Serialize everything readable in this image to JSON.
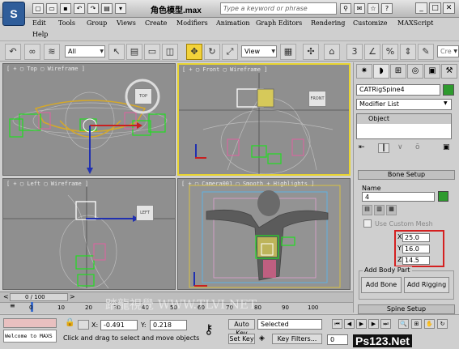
{
  "window": {
    "doc_title": "角色模型.max",
    "search_placeholder": "Type a keyword or phrase"
  },
  "menu": {
    "items": [
      "Edit",
      "Tools",
      "Group",
      "Views",
      "Create",
      "Modifiers",
      "Animation",
      "Graph Editors",
      "Rendering",
      "Customize",
      "MAXScript",
      "Help"
    ]
  },
  "toolbar": {
    "filter": "All",
    "ref_coord": "View"
  },
  "viewports": {
    "top": {
      "label": "[ + ▢ Top ▢ Wireframe ]",
      "cube": "TOP"
    },
    "front": {
      "label": "[ + ▢ Front ▢ Wireframe ]",
      "cube": "FRONT"
    },
    "left": {
      "label": "[ + ▢ Left ▢ Wireframe ]",
      "cube": "LEFT"
    },
    "camera": {
      "label": "[ + ▢ Camera001 ▢ Smooth + Highlights ]"
    }
  },
  "command_panel": {
    "object_name": "CATRigSpine4",
    "object_color": "#2e9a2e",
    "modifier_list": "Modifier List",
    "stack_item": "Object",
    "bone_setup": {
      "header": "Bone Setup",
      "name_label": "Name",
      "name_value": "4",
      "custom_mesh": "Use Custom Mesh",
      "x_label": "X",
      "x_value": "25.0",
      "y_label": "Y",
      "y_value": "16.0",
      "z_label": "Z",
      "z_value": "14.5"
    },
    "add_body_part": {
      "header": "Add Body Part",
      "add_bone": "Add Bone",
      "add_rigging": "Add Rigging"
    },
    "spine_setup": "Spine Setup"
  },
  "timeline": {
    "frame_counter": "0 / 100",
    "ticks": [
      "0",
      "10",
      "20",
      "30",
      "40",
      "50",
      "60",
      "70",
      "80",
      "90",
      "100"
    ],
    "watermark": "踏龍視覺 WWW.TLVI.NET"
  },
  "status": {
    "welcome": "Welcome to MAXS",
    "x_label": "X:",
    "x_value": "-0.491",
    "y_label": "Y:",
    "y_value": "0.218",
    "auto_key": "Auto Key",
    "key_mode": "Selected",
    "set_key": "Set Key",
    "key_filters": "Key Filters...",
    "prompt": "Click and drag to select and move objects",
    "frame_value": "0",
    "ps_logo": "Ps123.Net"
  },
  "colors": {
    "selected_viewport": "#e8d430",
    "highlight_box": "#d42020"
  }
}
